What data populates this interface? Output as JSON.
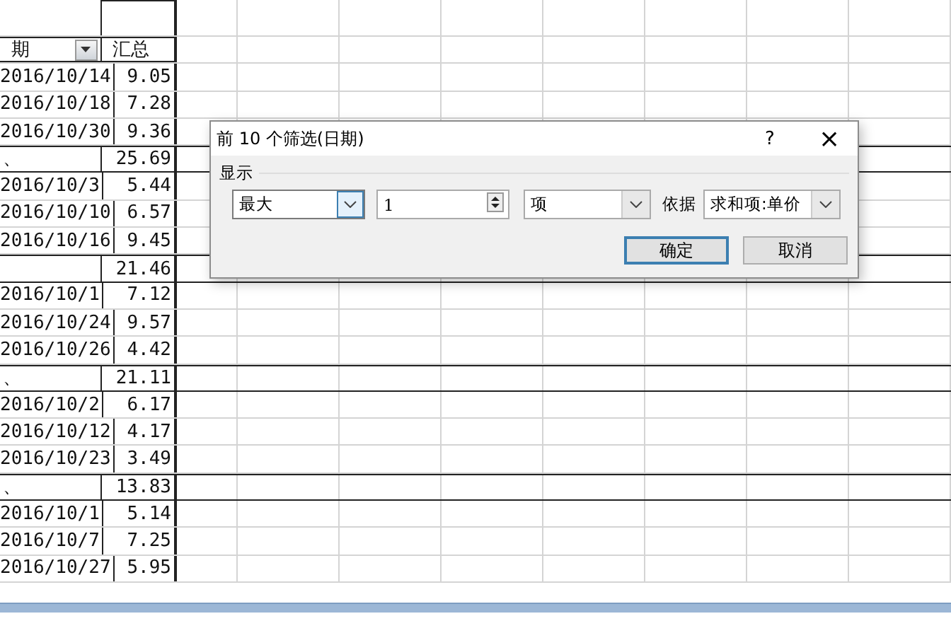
{
  "sheet": {
    "header": {
      "date": "期",
      "total": "汇总"
    },
    "rows": [
      {
        "kind": "item",
        "date": "2016/10/14",
        "total": "9.05"
      },
      {
        "kind": "item",
        "date": "2016/10/18",
        "total": "7.28"
      },
      {
        "kind": "item",
        "date": "2016/10/30",
        "total": "9.36"
      },
      {
        "kind": "subtotal",
        "date": "、",
        "total": "25.69"
      },
      {
        "kind": "item",
        "date": "2016/10/3",
        "total": "5.44"
      },
      {
        "kind": "item",
        "date": "2016/10/10",
        "total": "6.57"
      },
      {
        "kind": "item",
        "date": "2016/10/16",
        "total": "9.45"
      },
      {
        "kind": "subtotal",
        "date": "",
        "total": "21.46"
      },
      {
        "kind": "item",
        "date": "2016/10/1",
        "total": "7.12"
      },
      {
        "kind": "item",
        "date": "2016/10/24",
        "total": "9.57"
      },
      {
        "kind": "item",
        "date": "2016/10/26",
        "total": "4.42"
      },
      {
        "kind": "subtotal",
        "date": "、",
        "total": "21.11"
      },
      {
        "kind": "item",
        "date": "2016/10/2",
        "total": "6.17"
      },
      {
        "kind": "item",
        "date": "2016/10/12",
        "total": "4.17"
      },
      {
        "kind": "item",
        "date": "2016/10/23",
        "total": "3.49"
      },
      {
        "kind": "subtotal",
        "date": "、",
        "total": "13.83"
      },
      {
        "kind": "item",
        "date": "2016/10/1",
        "total": "5.14"
      },
      {
        "kind": "item",
        "date": "2016/10/7",
        "total": "7.25"
      },
      {
        "kind": "item",
        "date": "2016/10/27",
        "total": "5.95"
      }
    ]
  },
  "dialog": {
    "title": "前 10 个筛选(日期)",
    "help": "?",
    "close": "×",
    "group_label": "显示",
    "controls": [
      {
        "kind": "dropdown",
        "value": "最大",
        "focused": true
      },
      {
        "kind": "spinner",
        "value": "1"
      },
      {
        "kind": "dropdown",
        "value": "项",
        "focused": false
      },
      {
        "kind": "label",
        "text": "依据"
      },
      {
        "kind": "dropdown",
        "value": "求和项:单价",
        "focused": false
      }
    ],
    "buttons": [
      {
        "label": "确定",
        "default": true
      },
      {
        "label": "取消",
        "default": false
      }
    ]
  }
}
